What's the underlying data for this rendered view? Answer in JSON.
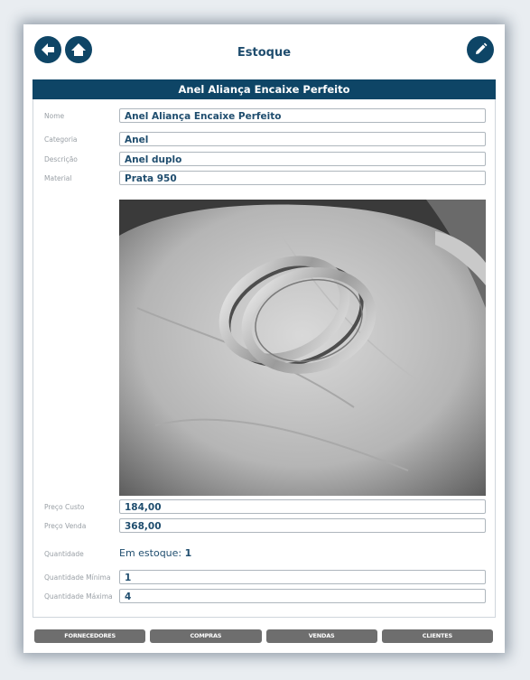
{
  "header": {
    "title": "Estoque",
    "back_icon": "back-arrow-icon",
    "home_icon": "home-icon",
    "edit_icon": "pencil-icon"
  },
  "product": {
    "title": "Anel Aliança Encaixe Perfeito"
  },
  "fields": {
    "nome": {
      "label": "Nome",
      "value": "Anel Aliança Encaixe Perfeito"
    },
    "categoria": {
      "label": "Categoria",
      "value": "Anel"
    },
    "descricao": {
      "label": "Descrição",
      "value": "Anel duplo"
    },
    "material": {
      "label": "Material",
      "value": "Prata 950"
    },
    "preco_custo": {
      "label": "Preço Custo",
      "value": "184,00"
    },
    "preco_venda": {
      "label": "Preço Venda",
      "value": "368,00"
    },
    "quantidade": {
      "label": "Quantidade",
      "prefix": "Em estoque: ",
      "value": "1"
    },
    "quantidade_minima": {
      "label": "Quantidade Mínima",
      "value": "1"
    },
    "quantidade_maxima": {
      "label": "Quantidade Máxima",
      "value": "4"
    }
  },
  "tabs": [
    {
      "label": "FORNECEDORES"
    },
    {
      "label": "COMPRAS"
    },
    {
      "label": "VENDAS"
    },
    {
      "label": "CLIENTES"
    }
  ],
  "colors": {
    "primary": "#0e4566",
    "tab": "#6e6e6e",
    "text": "#1f4d6e"
  }
}
